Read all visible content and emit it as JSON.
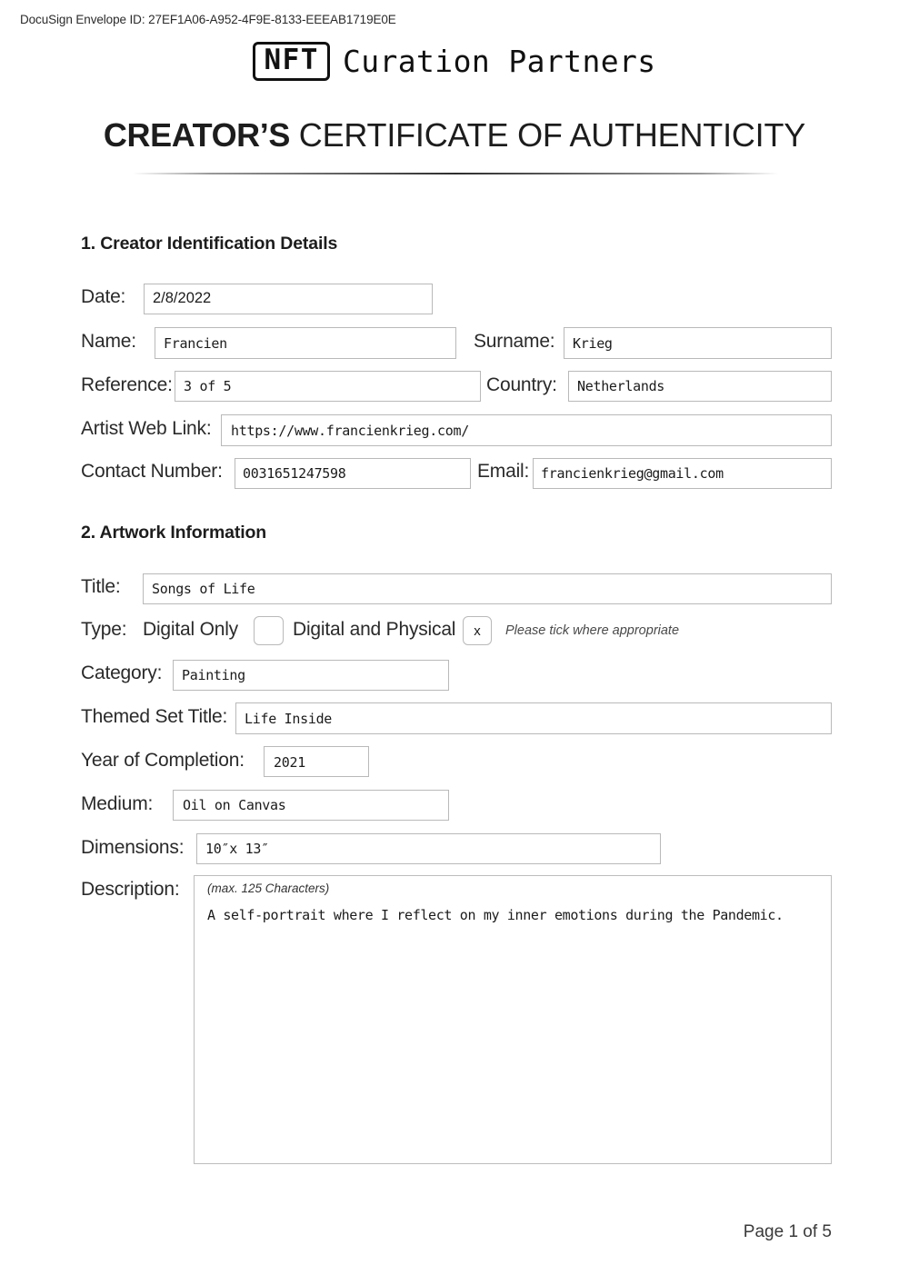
{
  "docusign": {
    "envelope_text": "DocuSign Envelope ID: 27EF1A06-A952-4F9E-8133-EEEAB1719E0E"
  },
  "brand": {
    "mark": "NFT",
    "name": "Curation Partners"
  },
  "title": {
    "emphasis": "CREATOR’S",
    "rest": "CERTIFICATE OF AUTHENTICITY"
  },
  "sections": {
    "creator": {
      "heading": "1. Creator Identification Details",
      "fields": {
        "date": {
          "label": "Date:",
          "value": "2/8/2022"
        },
        "name": {
          "label": "Name:",
          "value": "Francien"
        },
        "surname": {
          "label": "Surname:",
          "value": "Krieg"
        },
        "reference": {
          "label": "Reference:",
          "value": "3 of 5"
        },
        "country": {
          "label": "Country:",
          "value": "Netherlands"
        },
        "web_link": {
          "label": "Artist Web Link:",
          "value": "https://www.francienkrieg.com/"
        },
        "contact_number": {
          "label": "Contact Number:",
          "value": "0031651247598"
        },
        "email": {
          "label": "Email:",
          "value": "francienkrieg@gmail.com"
        }
      }
    },
    "artwork": {
      "heading": "2. Artwork Information",
      "fields": {
        "artwork_title": {
          "label": "Title:",
          "value": "Songs of Life"
        },
        "type": {
          "label": "Type:",
          "option_digital_only": "Digital Only",
          "option_digital_physical": "Digital and Physical",
          "digital_only_mark": "",
          "digital_physical_mark": "x",
          "hint": "Please tick where appropriate"
        },
        "category": {
          "label": "Category:",
          "value": "Painting"
        },
        "themed_set_title": {
          "label": "Themed Set Title:",
          "value": "Life Inside"
        },
        "year_of_completion": {
          "label": "Year of Completion:",
          "value": "2021"
        },
        "medium": {
          "label": "Medium:",
          "value": "Oil on Canvas"
        },
        "dimensions": {
          "label": "Dimensions:",
          "value": "10″x 13″"
        },
        "description": {
          "label": "Description:",
          "hint": "(max. 125 Characters)",
          "value": "A self-portrait where I reflect on my inner emotions during the Pandemic."
        }
      }
    }
  },
  "footer": {
    "page_indicator": "Page 1 of 5"
  },
  "colors": {
    "text": "#231f20",
    "field_border": "#b9b9b9",
    "hint": "#4a4a4a"
  }
}
